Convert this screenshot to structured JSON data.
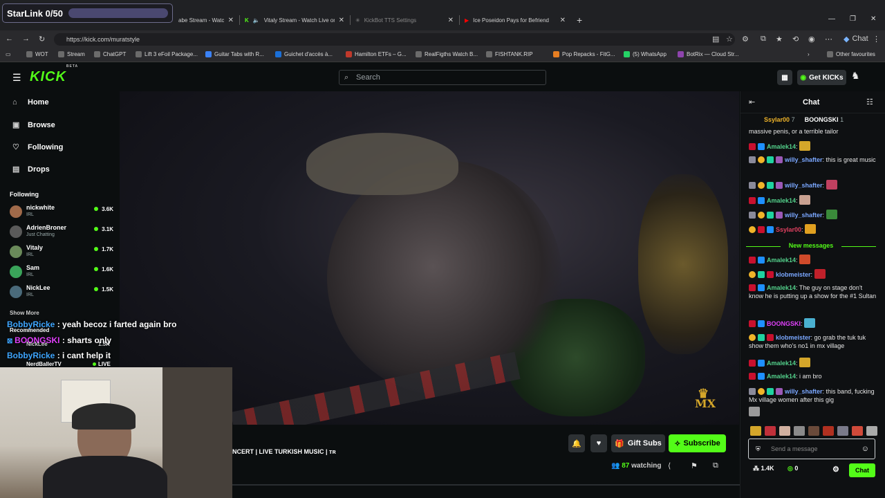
{
  "starlink": {
    "label": "StarLink 0/50"
  },
  "tabs": [
    {
      "title": "abe Stream - Watch L"
    },
    {
      "title": "Vitaly Stream - Watch Live on"
    },
    {
      "title": "KickBot TTS Settings"
    },
    {
      "title": "Ice Poseidon Pays for Befriending"
    }
  ],
  "address": {
    "url": "https://kick.com/muratstyle"
  },
  "bookmarks": [
    "WOT",
    "Stream",
    "ChatGPT",
    "Lift 3 eFoil Package...",
    "Guitar Tabs with R...",
    "Guichet d'accès à...",
    "Hamilton ETFs – G...",
    "RealFigths Watch B...",
    "FISHTANK.RIP",
    "Pop Repacks - FitG...",
    "(5) WhatsApp",
    "BotRix — Cloud Str..."
  ],
  "bookmarks_other": "Other favourites",
  "browser_chat": "Chat",
  "header": {
    "brand": "KICK",
    "beta": "BETA",
    "search_placeholder": "Search",
    "get_kicks": "Get KICKs"
  },
  "sidebar": {
    "nav": [
      {
        "label": "Home"
      },
      {
        "label": "Browse"
      },
      {
        "label": "Following"
      },
      {
        "label": "Drops"
      }
    ],
    "following_title": "Following",
    "following": [
      {
        "name": "nickwhite",
        "category": "IRL",
        "viewers": "3.6K"
      },
      {
        "name": "AdrienBroner",
        "category": "Just Chatting",
        "viewers": "3.1K"
      },
      {
        "name": "Vitaly",
        "category": "IRL",
        "viewers": "1.7K"
      },
      {
        "name": "Sam",
        "category": "IRL",
        "viewers": "1.6K"
      },
      {
        "name": "NickLee",
        "category": "IRL",
        "viewers": "1.5K"
      }
    ],
    "show_more": "Show More",
    "recommended": "Recommended",
    "rec_items": [
      {
        "name": "NickLee",
        "viewers": "1.5K"
      },
      {
        "name": "NerdBallerTV",
        "viewers": "LIVE"
      }
    ]
  },
  "overlay_chat": [
    {
      "user": "BobbyRicke",
      "text": " : yeah becoz i farted again bro"
    },
    {
      "user": "BOONGSKI",
      "text": " : sharts only"
    },
    {
      "user": "BobbyRicke",
      "text": " : i cant help it"
    }
  ],
  "stream": {
    "title": "NCERT | LIVE TURKISH MUSIC | ᴛʀ",
    "watching_count": "87",
    "watching_label": "watching",
    "gift_label": "Gift Subs",
    "subscribe_label": "Subscribe",
    "mx": "MX"
  },
  "chat": {
    "title": "Chat",
    "pinned": [
      {
        "name": "Ssylar00",
        "count": "7"
      },
      {
        "name": "BOONGSKI",
        "count": "1"
      }
    ],
    "partial": "massive penis, or a terrible tailor",
    "messages": [
      {
        "user": "Amalek14",
        "text": ""
      },
      {
        "user": "willy_shafter",
        "text": "this is great music"
      },
      {
        "user": "willy_shafter",
        "text": ""
      },
      {
        "user": "Amalek14",
        "text": ""
      },
      {
        "user": "willy_shafter",
        "text": ""
      },
      {
        "user": "Ssylar00",
        "text": ""
      }
    ],
    "new_messages": "New messages",
    "messages2": [
      {
        "user": "Amalek14",
        "text": ""
      },
      {
        "user": "klobmeister",
        "text": ""
      },
      {
        "user": "Amalek14",
        "text": "The guy on stage don't know he is putting up a show for the #1 Sultan"
      },
      {
        "user": "BOONGSKI",
        "text": ""
      },
      {
        "user": "klobmeister",
        "text": "go grab the tuk tuk show them who's no1 in mx village"
      },
      {
        "user": "Amalek14",
        "text": ""
      },
      {
        "user": "Amalek14",
        "text": "i am bro"
      },
      {
        "user": "willy_shafter",
        "text": "this band, fucking Mx village women after this gig"
      }
    ],
    "input_placeholder": "Send a message",
    "followers": "1.4K",
    "points": "0",
    "send_label": "Chat"
  },
  "colors": {
    "brand": "#53fc18",
    "bg": "#0b0e0f"
  }
}
